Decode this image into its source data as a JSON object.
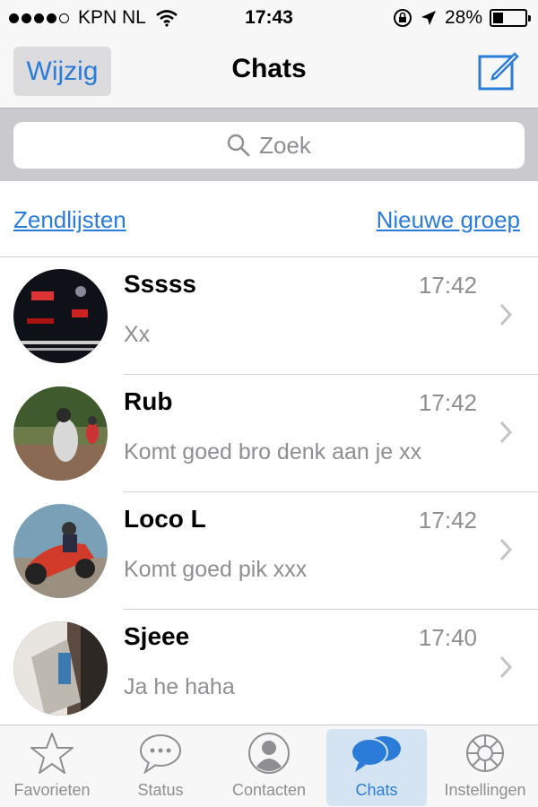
{
  "status_bar": {
    "carrier": "KPN NL",
    "time": "17:43",
    "battery": "28%",
    "battery_level": 0.28
  },
  "nav": {
    "edit_label": "Wijzig",
    "title": "Chats",
    "compose_icon": "compose-icon"
  },
  "search": {
    "placeholder": "Zoek"
  },
  "links": {
    "broadcast": "Zendlijsten",
    "new_group": "Nieuwe groep"
  },
  "chats": [
    {
      "name": "Sssss",
      "time": "17:42",
      "preview": "Xx"
    },
    {
      "name": "Rub",
      "time": "17:42",
      "preview": "Komt goed bro denk aan je xx"
    },
    {
      "name": "Loco L",
      "time": "17:42",
      "preview": "Komt goed pik xxx"
    },
    {
      "name": "Sjeee",
      "time": "17:40",
      "preview": "Ja he haha"
    }
  ],
  "tabs": [
    {
      "label": "Favorieten",
      "icon": "star-icon",
      "active": false
    },
    {
      "label": "Status",
      "icon": "chat-bubble-dots-icon",
      "active": false
    },
    {
      "label": "Contacten",
      "icon": "person-icon",
      "active": false
    },
    {
      "label": "Chats",
      "icon": "chats-icon",
      "active": true
    },
    {
      "label": "Instellingen",
      "icon": "gear-icon",
      "active": false
    }
  ],
  "colors": {
    "accent": "#2b7cd9",
    "muted": "#8e8e93",
    "bar_bg": "#f7f7f7",
    "search_bg": "#c9c9ce"
  }
}
